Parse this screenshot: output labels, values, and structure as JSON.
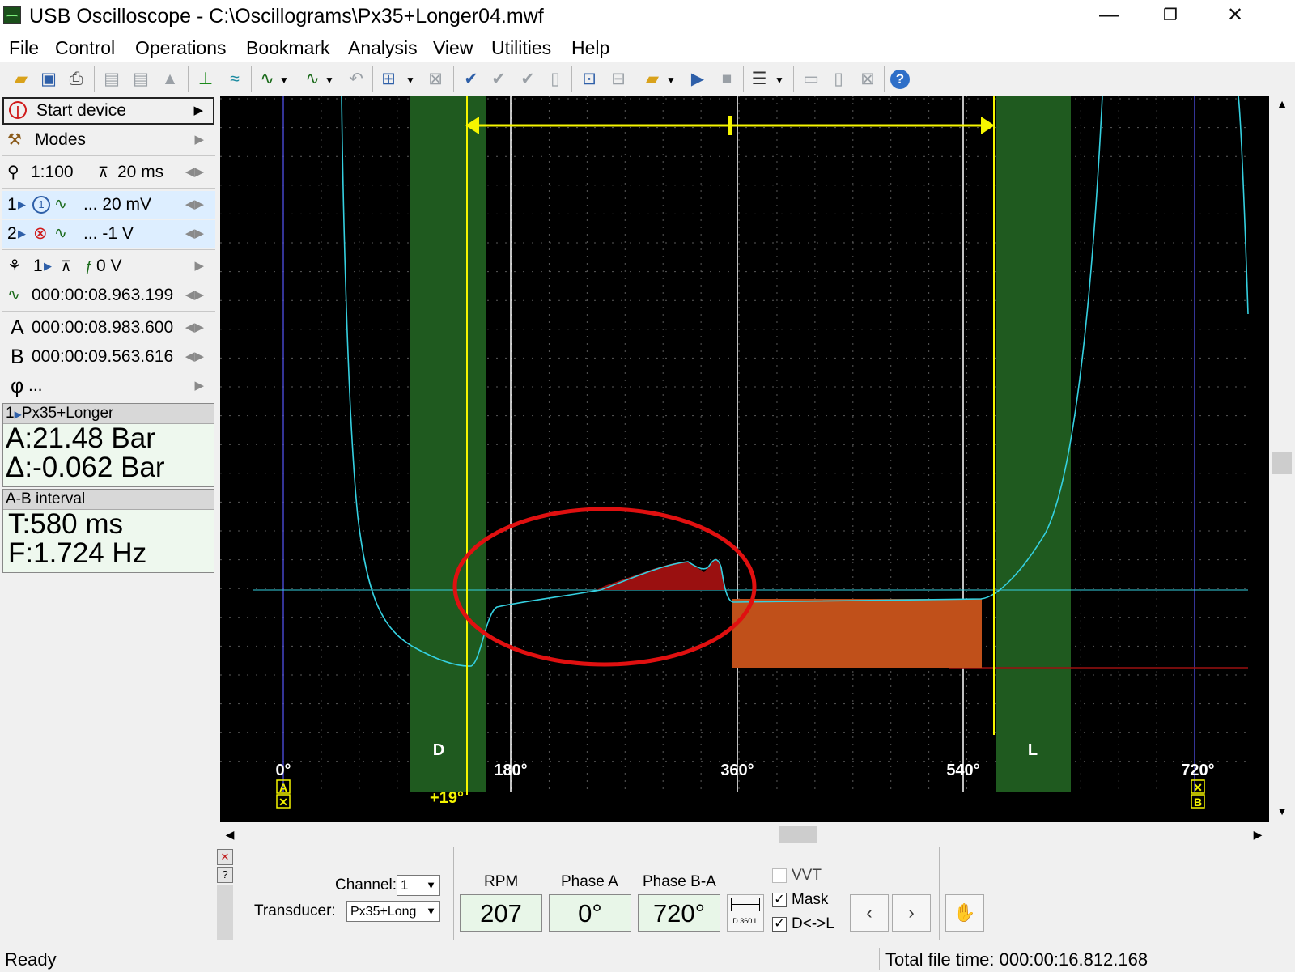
{
  "window": {
    "title": "USB Oscilloscope - C:\\Oscillograms\\Px35+Longer04.mwf",
    "minimize_glyph": "—",
    "restore_glyph": "❐",
    "close_glyph": "✕"
  },
  "menu": [
    "File",
    "Control",
    "Operations",
    "Bookmark",
    "Analysis",
    "View",
    "Utilities",
    "Help"
  ],
  "left_panel": {
    "start_device": "Start device",
    "modes": "Modes",
    "zoom": "1:100",
    "timebase": "20 ms",
    "channel1": {
      "index": "1",
      "label": "... 20 mV"
    },
    "channel2": {
      "index": "2",
      "label": "... -1 V"
    },
    "trigger": {
      "index": "1",
      "level": "0 V"
    },
    "trigger_time": "000:00:08.963.199",
    "cursor_a": {
      "label": "A",
      "value": "000:00:08.983.600"
    },
    "cursor_b": {
      "label": "B",
      "value": "000:00:09.563.616"
    },
    "phi": {
      "label": "φ",
      "value": "..."
    },
    "measure_header": "Px35+Longer",
    "measure_a": "A:21.48 Bar",
    "measure_delta": "Δ:-0.062 Bar",
    "interval_header": "A-B interval",
    "interval_t": "T:580 ms",
    "interval_f": "F:1.724 Hz"
  },
  "scope": {
    "angle_labels": [
      "0°",
      "180°",
      "360°",
      "540°",
      "720°"
    ],
    "zone_d": "D",
    "zone_l": "L",
    "offset_label": "+19°",
    "marker_a": "A",
    "marker_b": "B",
    "colors": {
      "background": "#000000",
      "grid": "#5a5a5a",
      "trace": "#35d0e0",
      "zone": "#1f5a1f",
      "marker": "#f5f500",
      "highlight_ellipse": "#e01010",
      "fill_dark_red": "#9a1010",
      "fill_orange": "#c0501a",
      "blue_axis": "#4646c8"
    }
  },
  "bottom_panel": {
    "channel_label": "Channel:",
    "channel_value": "1",
    "transducer_label": "Transducer:",
    "transducer_value": "Px35+Long",
    "rpm_label": "RPM",
    "rpm_value": "207",
    "phase_a_label": "Phase A",
    "phase_a_value": "0°",
    "phase_ba_label": "Phase B-A",
    "phase_ba_value": "720°",
    "d360l_label": "D 360 L",
    "vvt_label": "VVT",
    "vvt_checked": false,
    "mask_label": "Mask",
    "mask_checked": true,
    "dl_label": "D<->L",
    "dl_checked": true,
    "prev_glyph": "‹",
    "next_glyph": "›",
    "hand_glyph": "✋",
    "close_glyph": "✕",
    "help_glyph": "?"
  },
  "status": {
    "ready": "Ready",
    "total_time": "Total file time: 000:00:16.812.168"
  }
}
